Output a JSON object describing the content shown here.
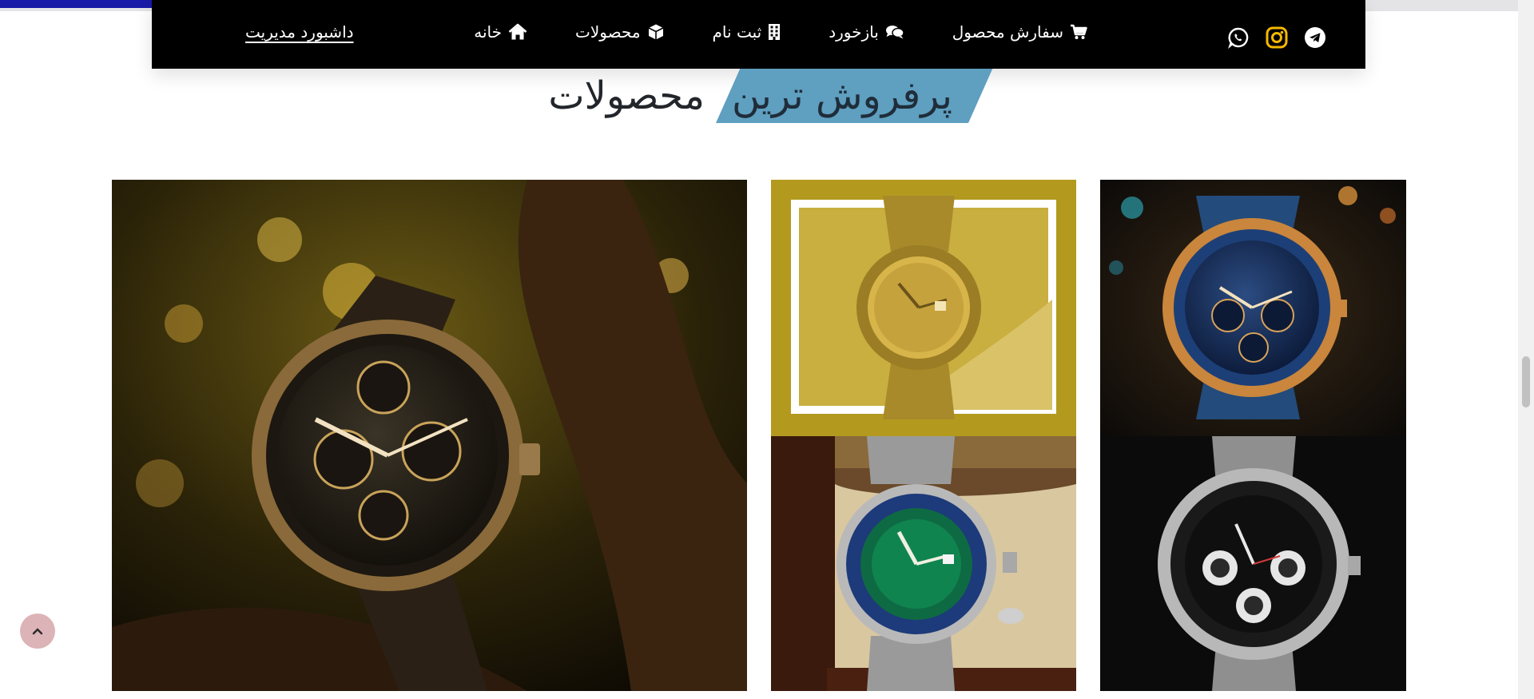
{
  "browser": {
    "progress_percent": 10,
    "scroll_position_fraction": 0.55
  },
  "navbar": {
    "social": [
      {
        "name": "telegram-icon"
      },
      {
        "name": "instagram-icon"
      },
      {
        "name": "whatsapp-icon"
      }
    ],
    "menu": [
      {
        "label": "سفارش محصول",
        "icon": "cart-icon"
      },
      {
        "label": "بازخورد",
        "icon": "comments-icon"
      },
      {
        "label": "ثبت نام",
        "icon": "building-icon"
      },
      {
        "label": "محصولات",
        "icon": "box-icon"
      },
      {
        "label": "خانه",
        "icon": "home-icon"
      }
    ],
    "dashboard_link": "داشبورد مدیریت"
  },
  "section": {
    "title_highlight": "پرفروش ترین",
    "title_rest": "محصولات"
  },
  "gallery": [
    {
      "name": "product-image-blue-gold-chronograph"
    },
    {
      "name": "product-image-gold-watch-framed"
    },
    {
      "name": "product-image-black-chronograph-branch"
    },
    {
      "name": "product-image-silver-black-chronograph"
    },
    {
      "name": "product-image-green-dial-diver"
    }
  ],
  "colors": {
    "navbar_bg": "#000000",
    "heading_accent": "#5f9fc0",
    "back_to_top_bg": "#dcb3b6",
    "progress_bar": "#1a1aa8"
  },
  "back_to_top": {
    "icon": "chevron-up-icon"
  }
}
